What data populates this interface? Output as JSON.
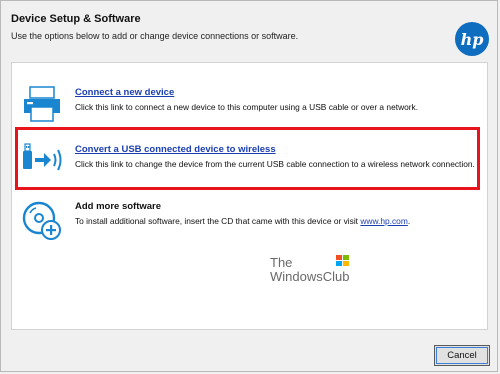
{
  "window": {
    "title": "Device Setup & Software",
    "subtitle": "Use the options below to add or change device connections or software."
  },
  "logo": {
    "text": "hp",
    "icon": "hp-logo-icon",
    "color": "#0f6dbf"
  },
  "options": [
    {
      "label": "Connect a new device",
      "description": "Click this link to connect a new device to this computer using a USB cable or over a network.",
      "icon": "printer-icon"
    },
    {
      "label": "Convert a USB connected device to wireless",
      "description": "Click this link to change the device from the current USB cable connection to a wireless network connection.",
      "icon": "usb-to-wireless-icon",
      "highlighted": true
    },
    {
      "label": "Add more software",
      "description_prefix": "To install additional software, insert the CD that came with this device or visit ",
      "description_link": "www.hp.com",
      "description_suffix": ".",
      "icon": "cd-add-icon"
    }
  ],
  "watermark": {
    "line1": "The",
    "line2": "WindowsClub"
  },
  "buttons": {
    "cancel": "Cancel"
  },
  "colors": {
    "link": "#1b3fb0",
    "highlight_border": "#e8141c",
    "icon_blue": "#1a86d0"
  }
}
